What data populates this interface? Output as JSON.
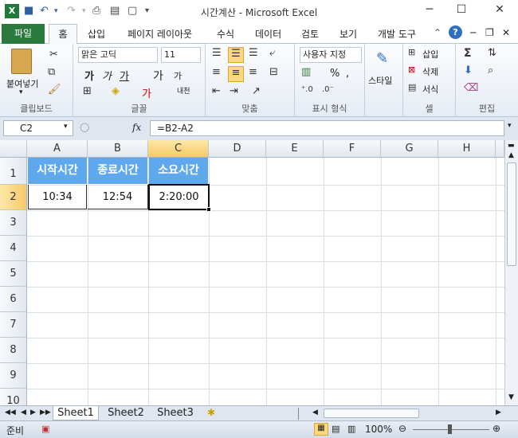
{
  "window": {
    "title": "시간계산  -  Microsoft Excel"
  },
  "tabs": [
    "파일",
    "홈",
    "삽입",
    "페이지 레이아웃",
    "수식",
    "데이터",
    "검토",
    "보기",
    "개발 도구"
  ],
  "ribbon": {
    "clipboard": {
      "label": "클립보드",
      "paste": "붙여넣기"
    },
    "font": {
      "label": "글꼴",
      "name": "맑은 고딕",
      "size": "11",
      "bold": "가",
      "italic": "가",
      "underline": "가",
      "grow": "가",
      "shrink": "가",
      "phonetic": "내천"
    },
    "alignment": {
      "label": "맞춤"
    },
    "number": {
      "label": "표시 형식",
      "format": "사용자 지정",
      "percent": "%"
    },
    "styles": {
      "label": "스타일",
      "button": "스타일"
    },
    "cells": {
      "label": "셀",
      "insert": "삽입",
      "delete": "삭제",
      "format": "서식"
    },
    "editing": {
      "label": "편집"
    }
  },
  "formula_bar": {
    "name_box": "C2",
    "fx": "fx",
    "formula": "=B2-A2"
  },
  "grid": {
    "columns": [
      "A",
      "B",
      "C",
      "D",
      "E",
      "F",
      "G",
      "H"
    ],
    "rows": [
      "1",
      "2",
      "3",
      "4",
      "5",
      "6",
      "7",
      "8",
      "9",
      "10"
    ],
    "headers": [
      "시작시간",
      "종료시간",
      "소요시간"
    ],
    "values": [
      "10:34",
      "12:54",
      "2:20:00"
    ],
    "selected_cell": "C2",
    "header_fill": "#5fa8ee"
  },
  "sheets": [
    "Sheet1",
    "Sheet2",
    "Sheet3"
  ],
  "status": {
    "mode": "준비",
    "zoom": "100%"
  }
}
